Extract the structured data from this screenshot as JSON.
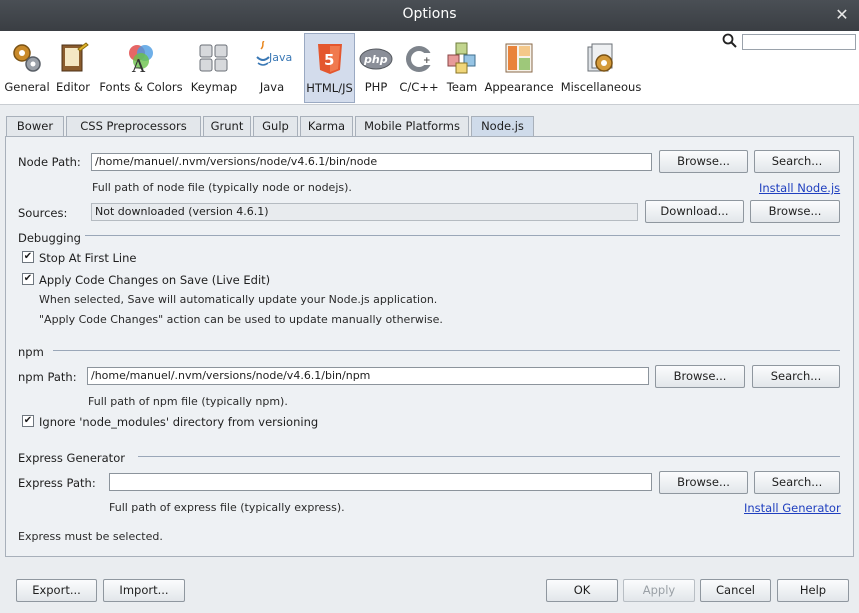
{
  "window": {
    "title": "Options"
  },
  "toolbar": {
    "categories": [
      {
        "label": "General",
        "icon": "gears-icon"
      },
      {
        "label": "Editor",
        "icon": "editor-icon"
      },
      {
        "label": "Fonts & Colors",
        "icon": "fonts-colors-icon"
      },
      {
        "label": "Keymap",
        "icon": "keymap-icon"
      },
      {
        "label": "Java",
        "icon": "java-icon"
      },
      {
        "label": "HTML/JS",
        "icon": "html5-icon"
      },
      {
        "label": "PHP",
        "icon": "php-icon"
      },
      {
        "label": "C/C++",
        "icon": "cpp-icon"
      },
      {
        "label": "Team",
        "icon": "team-icon"
      },
      {
        "label": "Appearance",
        "icon": "appearance-icon"
      },
      {
        "label": "Miscellaneous",
        "icon": "misc-icon"
      }
    ],
    "active_category": "HTML/JS",
    "search_value": ""
  },
  "tabs": [
    "Bower",
    "CSS Preprocessors",
    "Grunt",
    "Gulp",
    "Karma",
    "Mobile Platforms",
    "Node.js"
  ],
  "active_tab": "Node.js",
  "node": {
    "path_label": "Node Path:",
    "path_value": "/home/manuel/.nvm/versions/node/v4.6.1/bin/node",
    "path_hint": "Full path of node file (typically node or nodejs).",
    "browse": "Browse...",
    "search": "Search...",
    "install_link": "Install Node.js",
    "sources_label": "Sources:",
    "sources_value": "Not downloaded (version 4.6.1)",
    "download": "Download...",
    "sources_browse": "Browse..."
  },
  "debugging": {
    "title": "Debugging",
    "stop_first_line": "Stop At First Line",
    "stop_first_line_checked": true,
    "apply_changes": "Apply Code Changes on Save (Live Edit)",
    "apply_changes_checked": true,
    "hint1": "When selected, Save will automatically update your Node.js application.",
    "hint2": "\"Apply Code Changes\" action can be used to update manually otherwise."
  },
  "npm": {
    "title": "npm",
    "path_label": "npm Path:",
    "path_value": "/home/manuel/.nvm/versions/node/v4.6.1/bin/npm",
    "path_hint": "Full path of npm file (typically npm).",
    "browse": "Browse...",
    "search": "Search...",
    "ignore_modules": "Ignore 'node_modules' directory from versioning",
    "ignore_modules_checked": true
  },
  "express": {
    "title": "Express Generator",
    "path_label": "Express Path:",
    "path_value": "",
    "path_hint": "Full path of express file (typically express).",
    "browse": "Browse...",
    "search": "Search...",
    "install_link": "Install Generator",
    "message": "Express must be selected."
  },
  "footer": {
    "export": "Export...",
    "import": "Import...",
    "ok": "OK",
    "apply": "Apply",
    "cancel": "Cancel",
    "help": "Help"
  }
}
